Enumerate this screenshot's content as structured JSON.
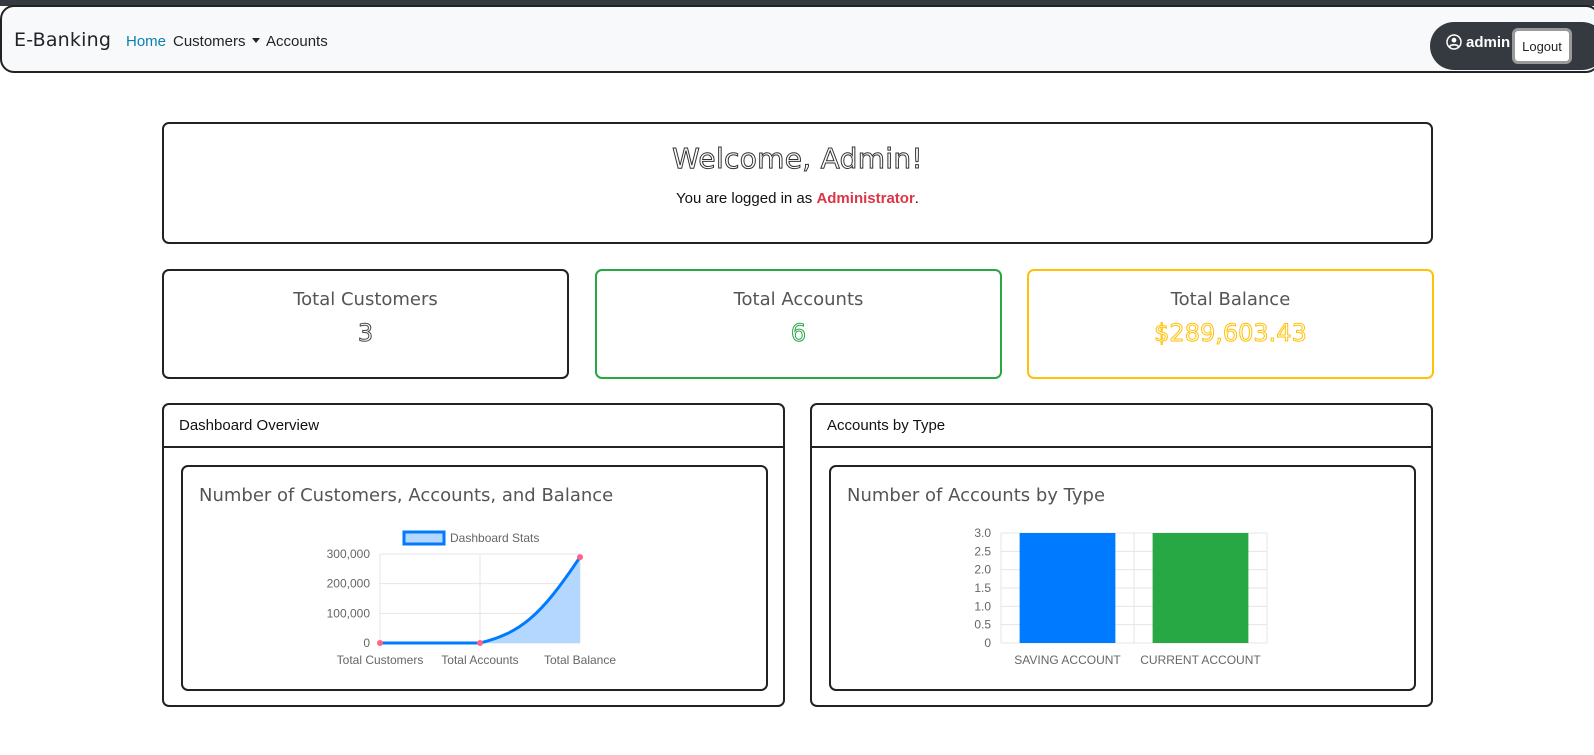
{
  "navbar": {
    "brand": "E-Banking",
    "links": {
      "home": "Home",
      "customers": "Customers",
      "accounts": "Accounts"
    },
    "user": "admin",
    "logout": "Logout",
    "active_color": "#0a7fb5"
  },
  "welcome": {
    "title": "Welcome, Admin!",
    "sub_prefix": "You are logged in as ",
    "role": "Administrator",
    "sub_suffix": "."
  },
  "stats": [
    {
      "label": "Total Customers",
      "value": "3",
      "color": "#444444"
    },
    {
      "label": "Total Accounts",
      "value": "6",
      "color": "#28a745"
    },
    {
      "label": "Total Balance",
      "value": "$289,603.43",
      "color": "#ffc107"
    }
  ],
  "panels": {
    "overview": {
      "header": "Dashboard Overview",
      "title": "Number of Customers, Accounts, and Balance"
    },
    "by_type": {
      "header": "Accounts by Type",
      "title": "Number of Accounts by Type"
    }
  },
  "chart_data": [
    {
      "type": "area",
      "categories": [
        "Total Customers",
        "Total Accounts",
        "Total Balance"
      ],
      "series": [
        {
          "name": "Dashboard Stats",
          "values": [
            3,
            6,
            289603.43
          ]
        }
      ],
      "ylim": [
        0,
        300000
      ],
      "yticks": [
        "0",
        "100,000",
        "200,000",
        "300,000"
      ],
      "legend": "top",
      "grid": true,
      "line_color": "#007bff",
      "fill_color": "#b3d7ff",
      "point_color": "#ff6384"
    },
    {
      "type": "bar",
      "categories": [
        "SAVING ACCOUNT",
        "CURRENT ACCOUNT"
      ],
      "values": [
        3,
        3
      ],
      "colors": [
        "#007bff",
        "#28a745"
      ],
      "ylim": [
        0,
        3
      ],
      "yticks": [
        "0",
        "0.5",
        "1.0",
        "1.5",
        "2.0",
        "2.5",
        "3.0"
      ],
      "grid": true
    }
  ]
}
